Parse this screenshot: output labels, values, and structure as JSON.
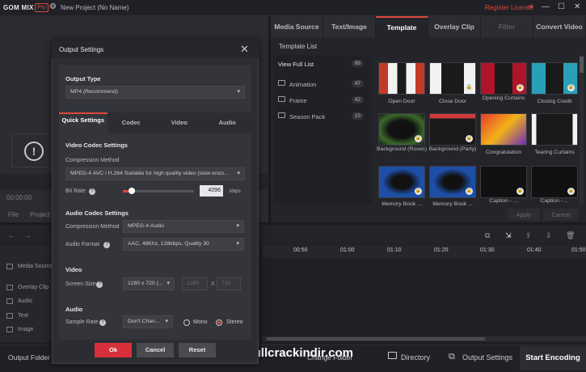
{
  "app": {
    "logo": "GOM MIX",
    "edition": "Pro",
    "project_name": "New Project (No Name)",
    "register_license": "Register License"
  },
  "preview": {
    "time_readout": "00:00:00",
    "tab_file": "File",
    "tab_project": "Project"
  },
  "right_tabs": [
    "Media Source",
    "Text/Image",
    "Template",
    "Overlay Clip",
    "Filter",
    "Convert Video"
  ],
  "template": {
    "list_label": "Template List",
    "view_full": {
      "label": "View Full List",
      "count": "99"
    },
    "categories": [
      {
        "label": "Animation",
        "count": "47"
      },
      {
        "label": "Frame",
        "count": "42"
      },
      {
        "label": "Season Pack",
        "count": "10"
      }
    ],
    "thumbs": [
      {
        "caption": "Open Door"
      },
      {
        "caption": "Close Door"
      },
      {
        "caption": "Opening Curtains"
      },
      {
        "caption": "Closing Credit"
      },
      {
        "caption": "Background (Roses)"
      },
      {
        "caption": "Background (Party)"
      },
      {
        "caption": "Congratulation"
      },
      {
        "caption": "Tearing Curtains"
      },
      {
        "caption": "Memory Book ..."
      },
      {
        "caption": "Memory Book ..."
      },
      {
        "caption": "Caption - ..."
      },
      {
        "caption": "Caption - ..."
      }
    ],
    "apply_label": "Apply",
    "cancel_label": "Cancel"
  },
  "timeline": {
    "ticks": [
      "00:50",
      "01:00",
      "01:10",
      "01:20",
      "01:30",
      "01:40",
      "01:50"
    ],
    "tracks": [
      "Media Source",
      "Overlay Clip",
      "Audio",
      "Text",
      "Image"
    ]
  },
  "bottom": {
    "output_folder": "Output Folder",
    "change_folder": "Change Folder",
    "directory": "Directory",
    "output_settings": "Output Settings",
    "start_encoding": "Start Encoding",
    "watermark": "www.fullcrackindir.com"
  },
  "dialog": {
    "title": "Output Settings",
    "output_type_label": "Output Type",
    "output_type_value": "MP4 (Recommend)",
    "tabs": [
      "Quick Settings",
      "Codec",
      "Video",
      "Audio"
    ],
    "video_codec_settings": "Video Codec Settings",
    "compression_method_label": "Compression Method",
    "video_compression_value": "MPEG-4 AVC / H.264 Suitable for high quality video (slow enco...",
    "bit_rate_label": "Bit Rate",
    "bit_rate_value": "4096",
    "bit_rate_unit": "kbps",
    "bit_rate_level": 0.12,
    "audio_codec_settings": "Audio Codec Settings",
    "audio_compression_value": "MPEG-4 Audio",
    "audio_format_label": "Audio Format",
    "audio_format_value": "AAC, 48Khz, 128kbps, Quality 30",
    "video_section": "Video",
    "screen_size_label": "Screen Size",
    "screen_size_value": "1280 x 720 (...",
    "width_value": "1280",
    "height_value": "720",
    "by": "X",
    "audio_section": "Audio",
    "sample_rate_label": "Sample Rate",
    "sample_rate_value": "Don't Chan...",
    "mono_label": "Mono",
    "stereo_label": "Stereo",
    "ok_label": "Ok",
    "cancel_label": "Cancel",
    "reset_label": "Reset"
  },
  "colors": {
    "accent": "#e0463d",
    "background": "#1b1c20",
    "panel": "#2c2d33"
  }
}
